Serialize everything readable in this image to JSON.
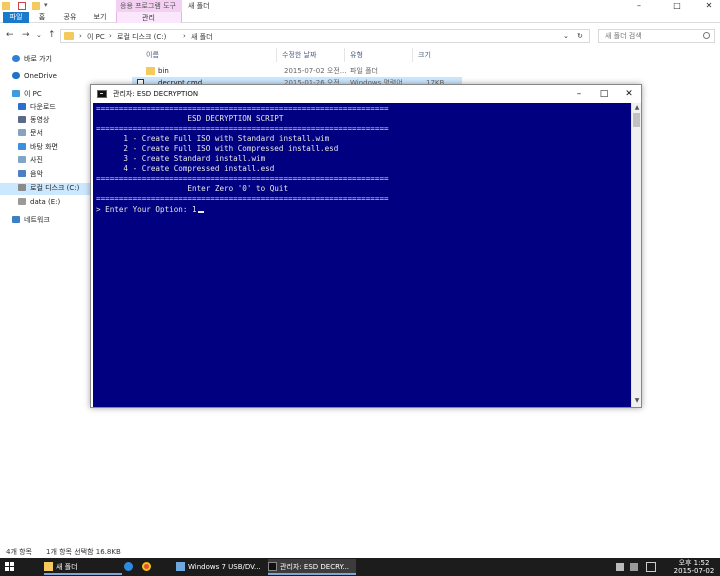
{
  "explorer": {
    "window_title": "새 폴더",
    "contextual_group": "응용 프로그램 도구",
    "contextual_tab": "관리",
    "ribbon_tabs": [
      "파일",
      "홈",
      "공유",
      "보기"
    ],
    "window_controls": [
      "–",
      "□",
      "✕"
    ],
    "address": {
      "crumbs": [
        "›",
        "이 PC",
        "›",
        "로컬 디스크 (C:)",
        "›",
        "새 폴더"
      ],
      "dropdown": "⌄",
      "refresh": "↻"
    },
    "search": {
      "placeholder": "새 폴더 검색"
    },
    "columns": [
      "이름",
      "수정한 날짜",
      "유형",
      "크기"
    ],
    "files": [
      {
        "name": "bin",
        "modified": "2015-07-02 오전...",
        "type": "파일 폴더",
        "size": ""
      },
      {
        "name": "decrypt.cmd",
        "modified": "2015-01-26 오전...",
        "type": "Windows 명령어...",
        "size": "17KB"
      }
    ],
    "sidebar": [
      {
        "label": "바로 가기",
        "icon": "star-icon"
      },
      {
        "label": "OneDrive",
        "icon": "cloud-icon"
      },
      {
        "label": "이 PC",
        "icon": "computer-icon"
      },
      {
        "label": "다운로드",
        "icon": "download-icon"
      },
      {
        "label": "동영상",
        "icon": "video-icon"
      },
      {
        "label": "문서",
        "icon": "document-icon"
      },
      {
        "label": "바탕 화면",
        "icon": "desktop-icon"
      },
      {
        "label": "사진",
        "icon": "picture-icon"
      },
      {
        "label": "음악",
        "icon": "music-icon"
      },
      {
        "label": "로컬 디스크 (C:)",
        "icon": "drive-icon"
      },
      {
        "label": "data (E:)",
        "icon": "drive-icon"
      },
      {
        "label": "네트워크",
        "icon": "network-icon"
      }
    ],
    "status": {
      "count": "4개 항목",
      "selection": "1개 항목 선택함 16.8KB"
    }
  },
  "console": {
    "title": "관리자:  ESD DECRYPTION",
    "controls": [
      "–",
      "□",
      "✕"
    ],
    "lines": [
      "================================================================",
      "                    ESD DECRYPTION SCRIPT",
      "================================================================",
      "      1 - Create Full ISO with Standard install.wim",
      "      2 - Create Full ISO with Compressed install.esd",
      "      3 - Create Standard install.wim",
      "      4 - Create Compressed install.esd",
      "================================================================",
      "                    Enter Zero '0' to Quit",
      "================================================================",
      "> Enter Your Option: 1"
    ]
  },
  "taskbar": {
    "tasks": [
      {
        "label": "새 폴더",
        "icon": "folder-icon"
      },
      {
        "label": "",
        "icon": "ie-icon"
      },
      {
        "label": "",
        "icon": "chrome-icon"
      },
      {
        "label": "Windows 7 USB/DV...",
        "icon": "usb-tool-icon"
      },
      {
        "label": "관리자:  ESD DECRY...",
        "icon": "cmd-icon"
      }
    ],
    "time": "오후 1:52",
    "date": "2015-07-02"
  },
  "colors": {
    "console_bg": "#000080",
    "console_text": "#e8e8e8",
    "accent": "#1979ca",
    "selection": "#cce8ff",
    "context_tab": "#f3cff2"
  }
}
